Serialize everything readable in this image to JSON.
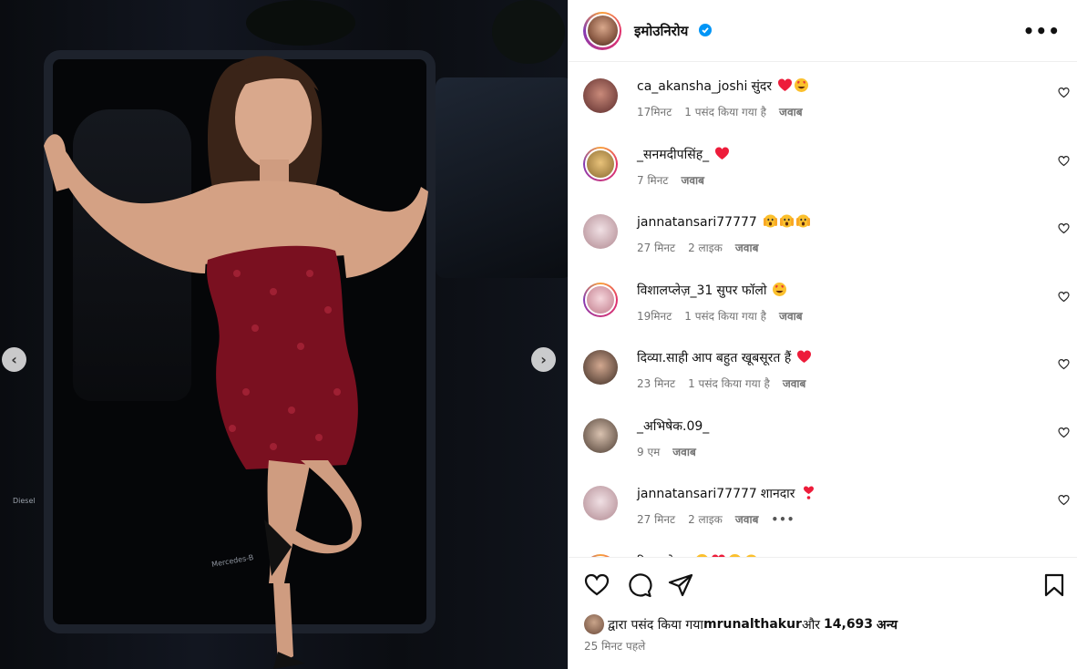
{
  "header": {
    "owner_name": "इमोउनिरोय",
    "more_label": "•••"
  },
  "media": {
    "car_brand_label": "Diesel",
    "step_label": "Mercedes-B"
  },
  "comments": [
    {
      "user": "ca_akansha_joshi",
      "text": "सुंदर",
      "emojis": [
        "heart",
        "heart-eyes"
      ],
      "time": "17मिनट",
      "likes": "1 पसंद किया गया है",
      "reply": "जवाब"
    },
    {
      "user": "_सनमदीपसिंह_",
      "text": "",
      "emojis": [
        "heart"
      ],
      "time": "7 मिनट",
      "likes": "",
      "reply": "जवाब"
    },
    {
      "user": "jannatansari77777",
      "text": "",
      "emojis": [
        "scream",
        "scream",
        "scream"
      ],
      "time": "27 मिनट",
      "likes": "2 लाइक",
      "reply": "जवाब"
    },
    {
      "user": "विशालप्लेज़_31",
      "text": "सुपर फॉलो",
      "emojis": [
        "heart-eyes"
      ],
      "time": "19मिनट",
      "likes": "1 पसंद किया गया है",
      "reply": "जवाब"
    },
    {
      "user": "दिव्या.साही",
      "text": "आप बहुत खूबसूरत हैं",
      "emojis": [
        "heart"
      ],
      "time": "23 मिनट",
      "likes": "1 पसंद किया गया है",
      "reply": "जवाब"
    },
    {
      "user": "_अभिषेक.09_",
      "text": "",
      "emojis": [],
      "time": "9 एम",
      "likes": "",
      "reply": "जवाब"
    },
    {
      "user": "jannatansari77777",
      "text": "शानदार",
      "emojis": [
        "heart-exclamation"
      ],
      "time": "27 मिनट",
      "likes": "2 लाइक",
      "reply": "जवाब",
      "more": "•••"
    },
    {
      "user": "रियाबाबेxx",
      "text": "",
      "emojis": [
        "heart-eyes",
        "heart",
        "heart-eyes",
        "scream"
      ],
      "time": "",
      "likes": "",
      "reply": ""
    }
  ],
  "footer": {
    "liked_by_prefix": "द्वारा पसंद किया गया",
    "liked_by_user": "mrunalthakur",
    "liked_by_and": "और",
    "liked_by_count": "14,693",
    "liked_by_others": "अन्य",
    "time_ago": "25 मिनट पहले"
  },
  "colors": {
    "verified": "#0095f6",
    "heart": "#ed1c3a",
    "meta": "#737373",
    "dress": "#7a1020"
  }
}
